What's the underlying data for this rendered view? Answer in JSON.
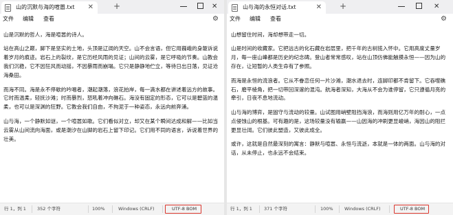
{
  "left_window": {
    "tab_title": "山的沉默与海的喧嚣.txt",
    "close_glyph": "✕",
    "new_tab_glyph": "+",
    "window_controls": {
      "close": "✕"
    },
    "menu": {
      "file": "文件",
      "edit": "编辑",
      "view": "查看"
    },
    "settings_icon": "gear-icon",
    "paragraphs": [
      "山是沉默的哲人，海是喧嚣的诗人。",
      "站在高山之巅，脚下是坚实的土地，头顶是辽阔的天空。山不会言语，但它用巍峨的身躯诉说着岁月的痕迹。岩石上的裂纹，是它历经风雨的见证；山间的云雾，是它呼吸的节奏。山教会我们沉稳，它不因狂风而动摇，不因暴雨而崩塌。它只是静静地伫立，等待日出日落，见证沧海桑田。",
      "而海不同。海是永不停歇的吟唱者，潮起潮落，浪花拍岸，每一滴水都在讲述着远方的故事。它时而温柔，轻抚沙滩；时而暴烈，怒吼着冲向礁石。海没有固定的形态，它可以是碧蓝的温柔，也可以是深渊的狂野。它教会我们自由，不拘泥于一种姿态，永远向前奔涌。",
      "山与海，一个静默如谜，一个喧嚣如歌。它们看似对立，却又在某个瞬间达成和解——比如当云雾从山间流向海面，或是潮汐在山脚的岩石上留下印记。它们用不同的语言，诉说着世界的壮美。"
    ],
    "status": {
      "position": "行 1，列 1",
      "char_count": "352 个字符",
      "zoom": "100%",
      "line_ending": "Windows (CRLF)",
      "encoding": "UTF-8 BOM"
    }
  },
  "right_window": {
    "tab_title": "山与海的永恒对话.txt",
    "close_glyph": "✕",
    "new_tab_glyph": "+",
    "window_controls": {
      "close": "✕"
    },
    "menu": {
      "file": "文件",
      "edit": "编辑",
      "view": "查看"
    },
    "settings_icon": "gear-icon",
    "paragraphs": [
      "山想留住时间，海却想带走一切。",
      "山是时间的收藏家。它把远古的化石藏在岩层里，把千年的古树揽入怀中。它用高度丈量岁月，每一座山峰都是历史的纪念碑。登山者常常感叹，站在山顶仿佛能触摸永恒——因为山的存在，让短暂的人类生命有了参照。",
      "而海是永恒的流浪者。它从不眷恋任何一片沙滩，潮水退去时，连脚印都不肯留下。它吞噬礁石，磨平棱角，把一切带回深邃的混沌。航海者深知，大海从不会为谁停留，它只遵循月亮的牵引，日夜不息地流动。",
      "山与海的博弈，是固守与流动的较量。山试图用峭壁阻挡海浪，而海则用亿万年的耐心，一点点侵蚀山的根基。可有趣的是，这场较量没有输赢——山因海的冲刷更显峻峭，海因山的阻拦更显壮阔。它们彼此塑造，又彼此成全。",
      "或许，这就是自然最深刻的寓言：静默与喧嚣、永恒与流逝，本就是一体的两面。山与海的对话，从未停止，也永远不会结束。"
    ],
    "status": {
      "position": "行 1，列 1",
      "char_count": "371 个字符",
      "zoom": "100%",
      "line_ending": "Windows (CRLF)",
      "encoding": "UTF-8 BOM"
    }
  },
  "colors": {
    "tabbar_bg": "#efeff1",
    "statusbar_bg": "#f3f3f3",
    "encoding_highlight": "#d9342b"
  }
}
